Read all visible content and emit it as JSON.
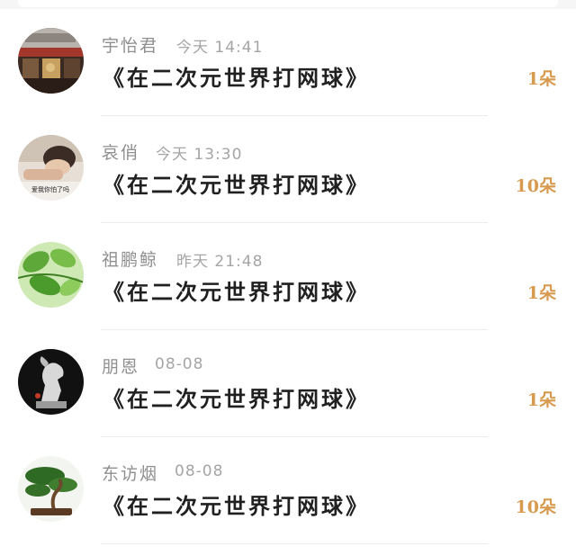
{
  "comments": [
    {
      "name": "宇怡君",
      "time": "今天 14:41",
      "title": "《在二次元世界打网球》",
      "count": "1朵",
      "avatar_icon": "storefront-photo-avatar"
    },
    {
      "name": "哀俏",
      "time": "今天 13:30",
      "title": "《在二次元世界打网球》",
      "count": "10朵",
      "avatar_icon": "sleeping-person-photo-avatar",
      "avatar_caption": "爱我你怕了吗"
    },
    {
      "name": "祖鹏鲸",
      "time": "昨天 21:48",
      "title": "《在二次元世界打网球》",
      "count": "1朵",
      "avatar_icon": "green-leaves-photo-avatar"
    },
    {
      "name": "朋恩",
      "time": "08-08",
      "title": "《在二次元世界打网球》",
      "count": "1朵",
      "avatar_icon": "horse-sculpture-photo-avatar"
    },
    {
      "name": "东访烟",
      "time": "08-08",
      "title": "《在二次元世界打网球》",
      "count": "10朵",
      "avatar_icon": "bonsai-tree-photo-avatar"
    }
  ],
  "colors": {
    "name": "#8f8f8f",
    "time": "#a5a5a5",
    "title": "#202020",
    "count": "#d79a4e"
  }
}
